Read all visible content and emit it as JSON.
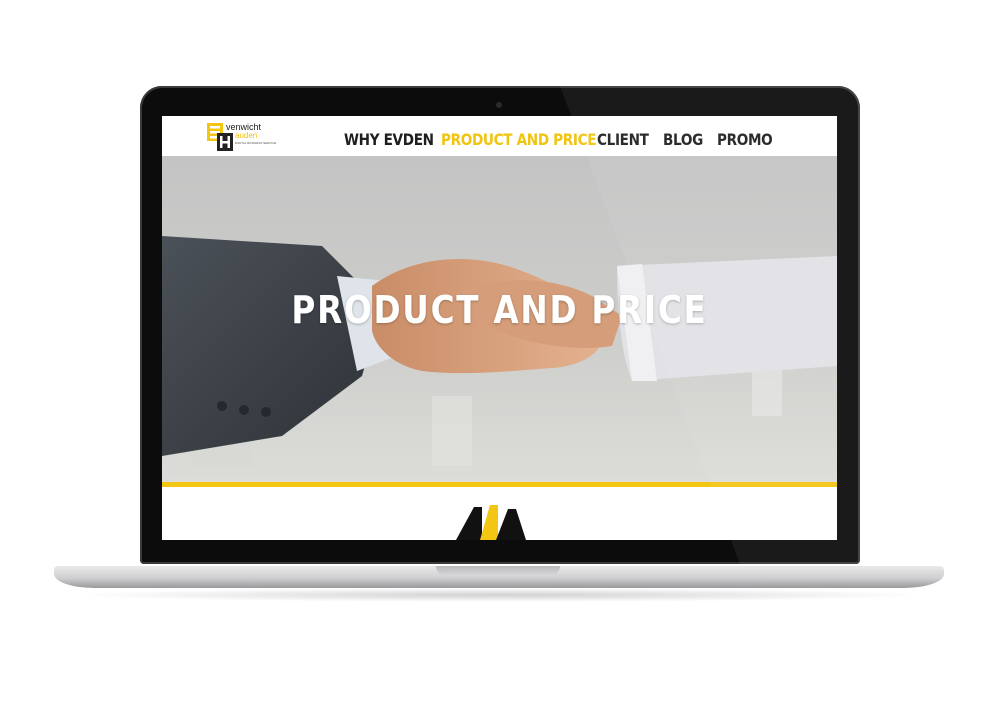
{
  "logo": {
    "line1": "venwicht",
    "line2": "auden",
    "tagline": "DIGITAL BUSINESS SERVICE"
  },
  "nav": {
    "items": [
      {
        "label": "WHY EVDEN"
      },
      {
        "label": "PRODUCT AND PRICE"
      },
      {
        "label": "CLIENT"
      },
      {
        "label": "BLOG"
      },
      {
        "label": "PROMO"
      }
    ]
  },
  "hero": {
    "title": "PRODUCT AND PRICE"
  },
  "colors": {
    "accent": "#f1c40f",
    "nav_text": "#1f1f1f",
    "bezel": "#0c0c0c"
  }
}
